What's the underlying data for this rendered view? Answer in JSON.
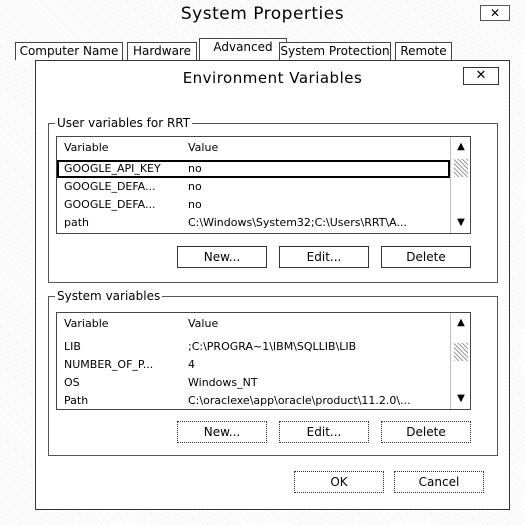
{
  "window": {
    "title": "System Properties",
    "close_label": "✕"
  },
  "tabs": [
    {
      "label": "Computer Name"
    },
    {
      "label": "Hardware"
    },
    {
      "label": "Advanced",
      "active": true
    },
    {
      "label": "System Protection"
    },
    {
      "label": "Remote"
    }
  ],
  "dialog": {
    "title": "Environment Variables",
    "close_label": "✕",
    "user_group": {
      "label": "User variables for RRT",
      "headers": {
        "variable": "Variable",
        "value": "Value"
      },
      "rows": [
        {
          "variable": "GOOGLE_API_KEY",
          "value": "no",
          "selected": true
        },
        {
          "variable": "GOOGLE_DEFA...",
          "value": "no"
        },
        {
          "variable": "GOOGLE_DEFA...",
          "value": "no"
        },
        {
          "variable": "path",
          "value": "C:\\Windows\\System32;C:\\Users\\RRT\\A..."
        }
      ],
      "buttons": {
        "new": "New...",
        "edit": "Edit...",
        "delete": "Delete"
      }
    },
    "system_group": {
      "label": "System variables",
      "headers": {
        "variable": "Variable",
        "value": "Value"
      },
      "rows": [
        {
          "variable": "LIB",
          "value": ";C:\\PROGRA~1\\IBM\\SQLLIB\\LIB"
        },
        {
          "variable": "NUMBER_OF_P...",
          "value": "4"
        },
        {
          "variable": "OS",
          "value": "Windows_NT"
        },
        {
          "variable": "Path",
          "value": "C:\\oraclexe\\app\\oracle\\product\\11.2.0\\..."
        }
      ],
      "buttons": {
        "new": "New...",
        "edit": "Edit...",
        "delete": "Delete"
      }
    },
    "footer": {
      "ok": "OK",
      "cancel": "Cancel"
    }
  }
}
